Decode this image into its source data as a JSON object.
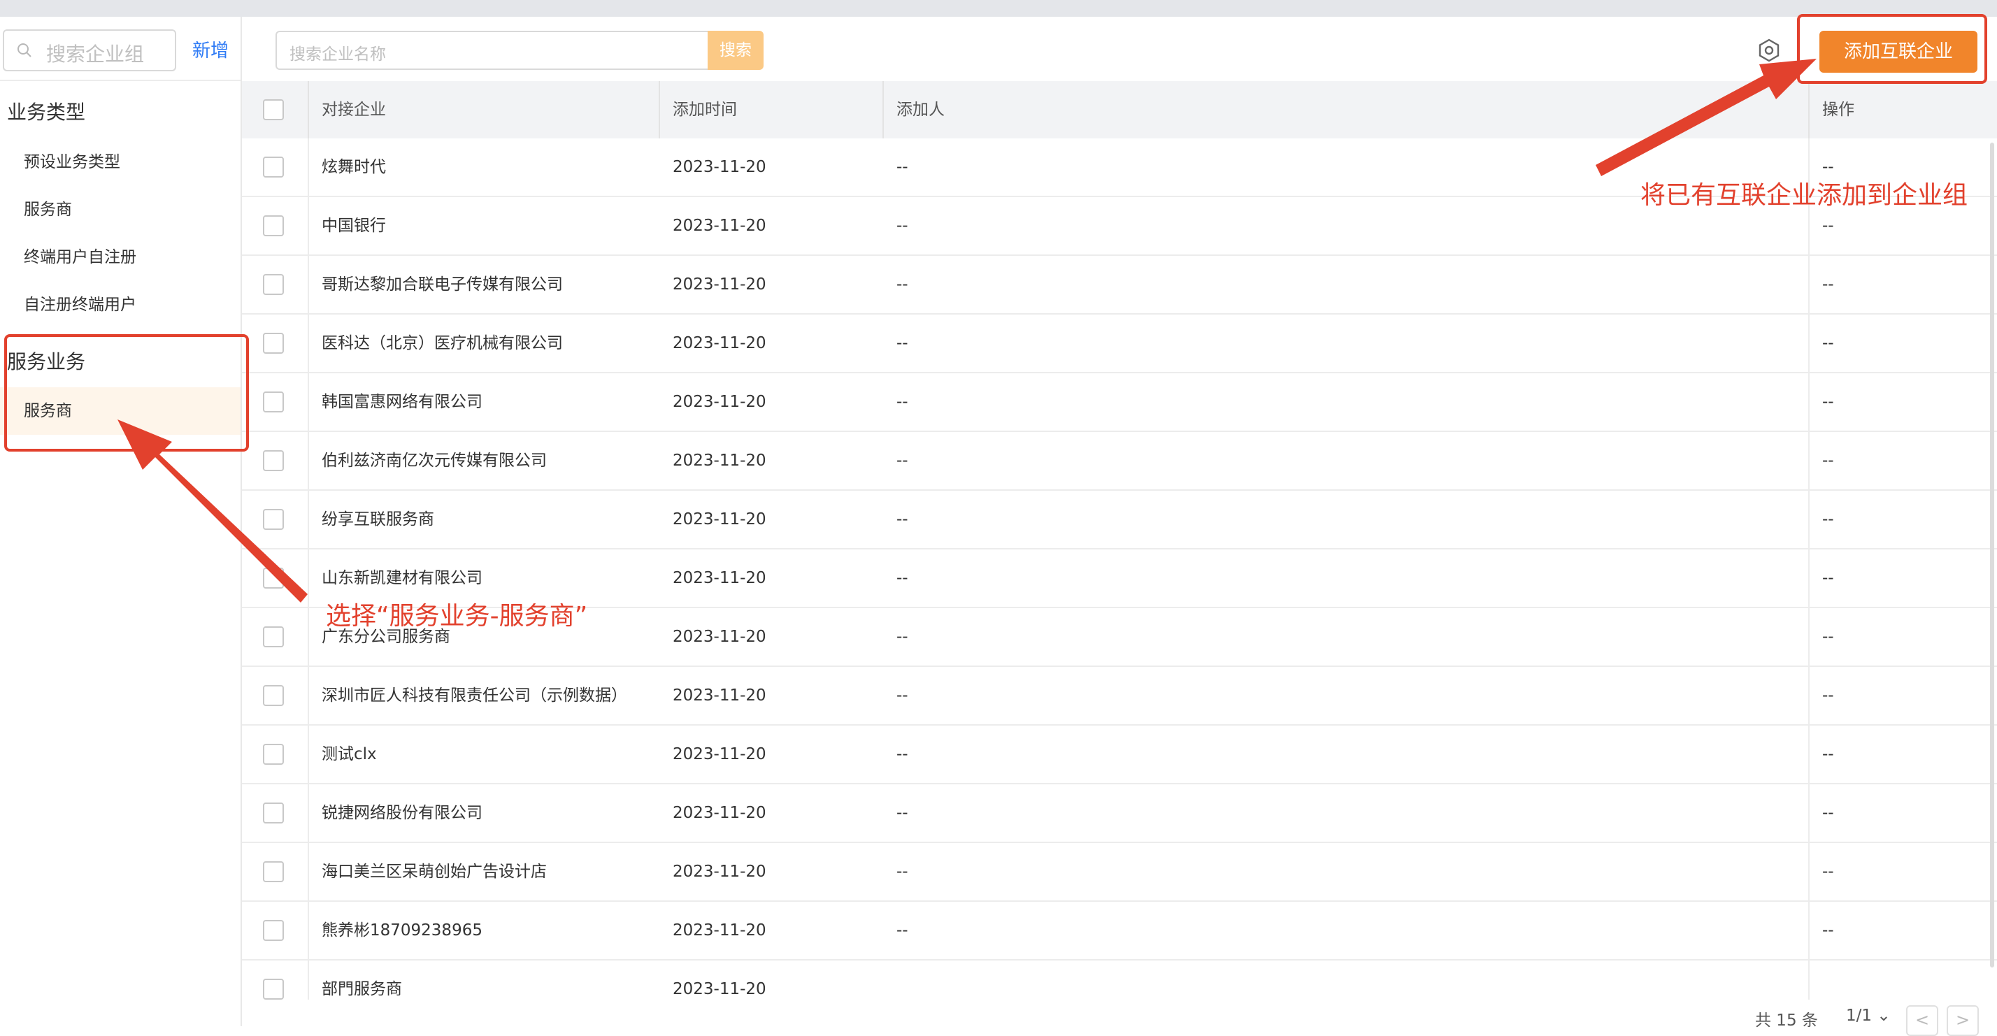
{
  "sidebar": {
    "search_placeholder": "搜索企业组",
    "new_label": "新增",
    "group1_title": "业务类型",
    "group1_items": [
      "预设业务类型",
      "服务商",
      "终端用户自注册",
      "自注册终端用户"
    ],
    "group2_title": "服务业务",
    "group2_items": [
      "服务商"
    ]
  },
  "toolbar": {
    "search_placeholder": "搜索企业名称",
    "search_button": "搜索",
    "add_button": "添加互联企业",
    "settings_icon": "gear-icon"
  },
  "table": {
    "columns": [
      "对接企业",
      "添加时间",
      "添加人",
      "操作"
    ],
    "rows": [
      {
        "company": "炫舞时代",
        "time": "2023-11-20",
        "adder": "--",
        "ops": "--"
      },
      {
        "company": "中国银行",
        "time": "2023-11-20",
        "adder": "--",
        "ops": "--"
      },
      {
        "company": "哥斯达黎加合联电子传媒有限公司",
        "time": "2023-11-20",
        "adder": "--",
        "ops": "--"
      },
      {
        "company": "医科达（北京）医疗机械有限公司",
        "time": "2023-11-20",
        "adder": "--",
        "ops": "--"
      },
      {
        "company": "韩国富惠网络有限公司",
        "time": "2023-11-20",
        "adder": "--",
        "ops": "--"
      },
      {
        "company": "伯利兹济南亿次元传媒有限公司",
        "time": "2023-11-20",
        "adder": "--",
        "ops": "--"
      },
      {
        "company": "纷享互联服务商",
        "time": "2023-11-20",
        "adder": "--",
        "ops": "--"
      },
      {
        "company": "山东新凯建材有限公司",
        "time": "2023-11-20",
        "adder": "--",
        "ops": "--"
      },
      {
        "company": "广东分公司服务商",
        "time": "2023-11-20",
        "adder": "--",
        "ops": "--"
      },
      {
        "company": "深圳市匠人科技有限责任公司（示例数据）",
        "time": "2023-11-20",
        "adder": "--",
        "ops": "--"
      },
      {
        "company": "测试clx",
        "time": "2023-11-20",
        "adder": "--",
        "ops": "--"
      },
      {
        "company": "锐捷网络股份有限公司",
        "time": "2023-11-20",
        "adder": "--",
        "ops": "--"
      },
      {
        "company": "海口美兰区呆萌创始广告设计店",
        "time": "2023-11-20",
        "adder": "--",
        "ops": "--"
      },
      {
        "company": "熊养彬18709238965",
        "time": "2023-11-20",
        "adder": "--",
        "ops": "--"
      },
      {
        "company": "部門服务商",
        "time": "2023-11-20",
        "adder": "",
        "ops": ""
      }
    ]
  },
  "pagination": {
    "total": "共 15 条",
    "page": "1/1",
    "prev": "<",
    "next": ">"
  },
  "annotations": {
    "left_note": "选择“服务业务-服务商”",
    "right_note": "将已有互联企业添加到企业组",
    "color": "#e2412d"
  }
}
